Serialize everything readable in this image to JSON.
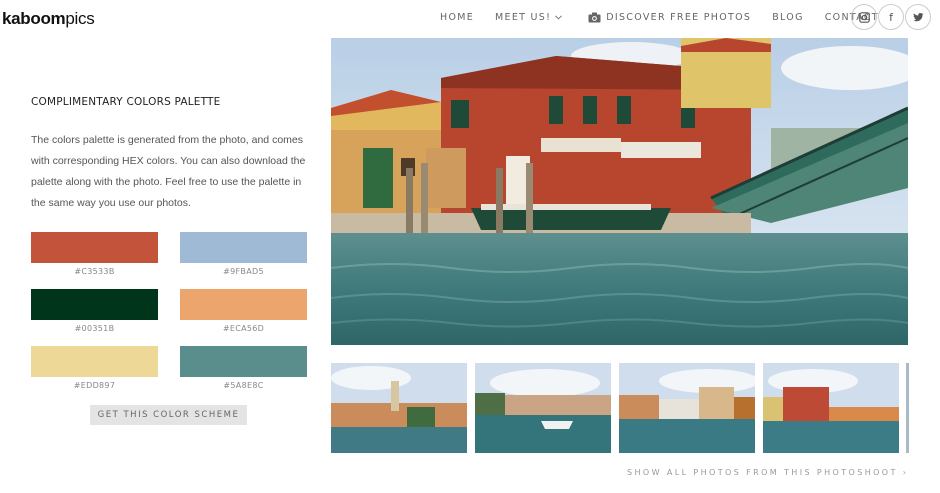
{
  "header": {
    "logo_bold": "kaboom",
    "logo_light": "pics",
    "nav": [
      "HOME",
      "MEET US!",
      "DISCOVER FREE PHOTOS",
      "BLOG",
      "CONTACT"
    ]
  },
  "social": {
    "facebook_glyph": "f"
  },
  "palette": {
    "title": "COMPLIMENTARY COLORS PALETTE",
    "description": "The colors palette is generated from the photo, and comes with corresponding HEX colors. You can also download the palette along with the photo. Feel free to use the palette in the same way you use our photos.",
    "colors": [
      {
        "hex_label": "#C3533B",
        "color": "#C3533B"
      },
      {
        "hex_label": "#9FBAD5",
        "color": "#9FBAD5"
      },
      {
        "hex_label": "#00351B",
        "color": "#00351B"
      },
      {
        "hex_label": "#ECA56D",
        "color": "#ECA56D"
      },
      {
        "hex_label": "#EDD897",
        "color": "#EDD897"
      },
      {
        "hex_label": "#5A8E8C",
        "color": "#5A8E8C"
      }
    ],
    "button_label": "GET THIS COLOR SCHEME"
  },
  "gallery": {
    "show_all_label": "SHOW ALL PHOTOS FROM THIS PHOTOSHOOT ›"
  }
}
